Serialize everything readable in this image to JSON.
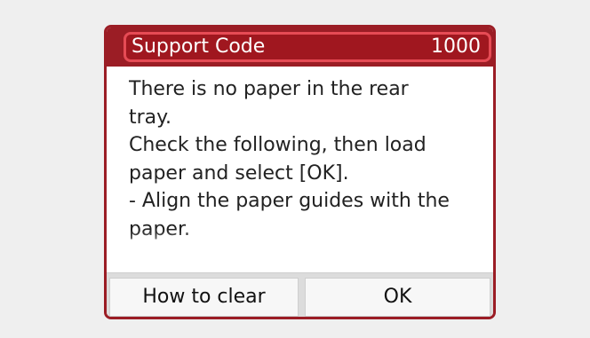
{
  "dialog": {
    "header": {
      "title": "Support Code",
      "code": "1000"
    },
    "message_lines": [
      "There is no paper in the rear",
      "tray.",
      "Check the following, then load",
      "paper and select [OK].",
      "- Align the paper guides with the",
      "paper."
    ],
    "buttons": {
      "how_to_clear": "How to clear",
      "ok": "OK"
    }
  },
  "colors": {
    "header_bg": "#9b1d25",
    "highlight_border": "#e64b55",
    "button_bar_bg": "#dcdcdc"
  }
}
